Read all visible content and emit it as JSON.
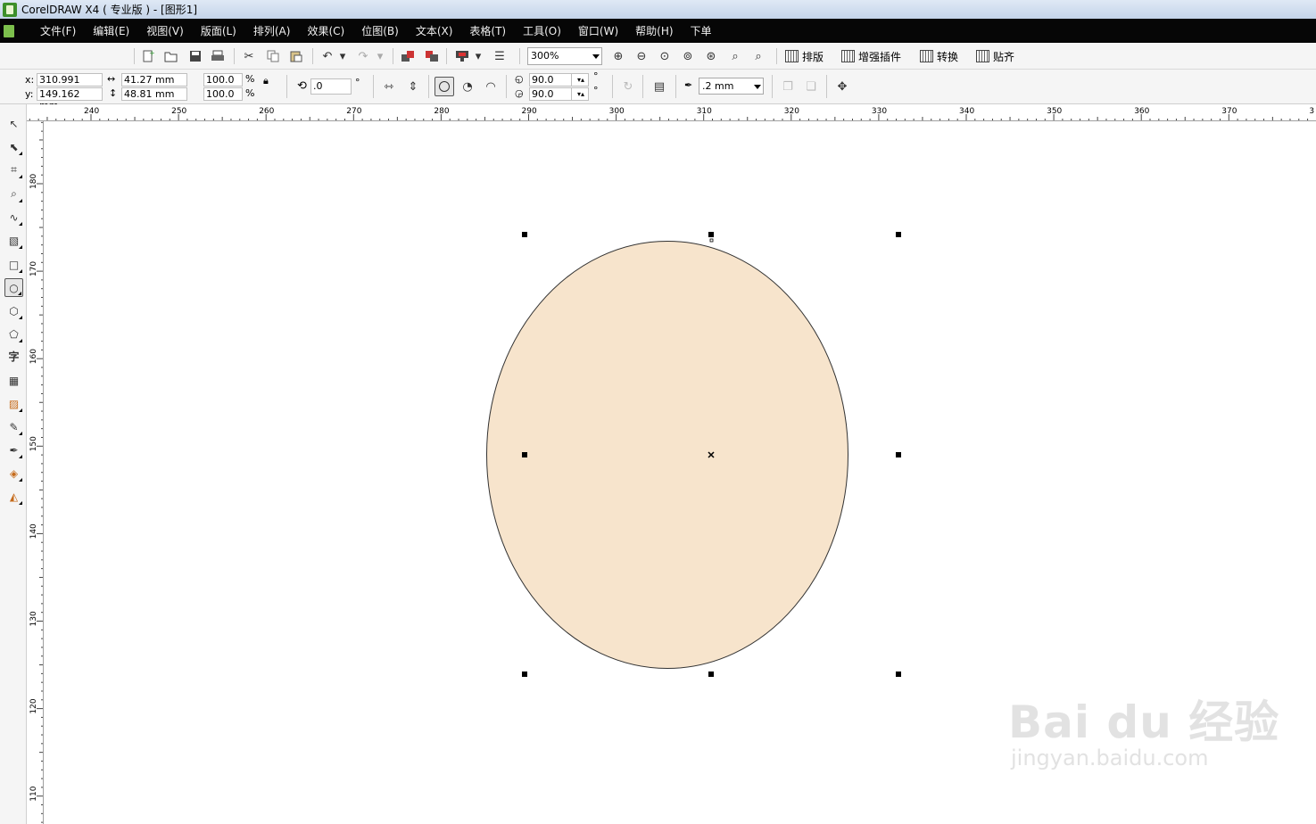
{
  "window": {
    "title": "CorelDRAW X4 ( 专业版 ) - [图形1]"
  },
  "menu": [
    "文件(F)",
    "编辑(E)",
    "视图(V)",
    "版面(L)",
    "排列(A)",
    "效果(C)",
    "位图(B)",
    "文本(X)",
    "表格(T)",
    "工具(O)",
    "窗口(W)",
    "帮助(H)",
    "下单"
  ],
  "toolbar": {
    "zoom_value": "300%",
    "plugins": [
      "排版",
      "增强插件",
      "转换",
      "贴齐"
    ]
  },
  "property_bar": {
    "x_label": "x:",
    "x_value": "310.991 mm",
    "y_label": "y:",
    "y_value": "149.162 mm",
    "width_value": "41.27 mm",
    "height_value": "48.81 mm",
    "scale_w": "100.0",
    "scale_h": "100.0",
    "percent": "%",
    "rotation": ".0",
    "degree": "°",
    "start_angle": "90.0",
    "end_angle": "90.0",
    "outline_width": ".2 mm"
  },
  "rulers": {
    "horizontal": [
      "240",
      "250",
      "260",
      "270",
      "280",
      "290",
      "300",
      "310",
      "320",
      "330",
      "340",
      "350",
      "360",
      "370",
      "3"
    ],
    "vertical": [
      "180",
      "170",
      "160",
      "150",
      "140",
      "130",
      "120",
      "110"
    ]
  },
  "toolbox": [
    "pick-tool",
    "shape-tool",
    "crop-tool",
    "zoom-tool",
    "freehand-tool",
    "smart-fill-tool",
    "rectangle-tool",
    "ellipse-tool",
    "polygon-tool",
    "basic-shapes-tool",
    "text-tool",
    "table-tool",
    "interactive-blend-tool",
    "eyedropper-tool",
    "outline-tool",
    "fill-tool",
    "interactive-fill-tool"
  ],
  "drawing": {
    "ellipse_fill": "#f7e4cc",
    "ellipse_stroke": "#333333"
  },
  "watermark": {
    "main": "Bai du 经验",
    "sub": "jingyan.baidu.com"
  }
}
